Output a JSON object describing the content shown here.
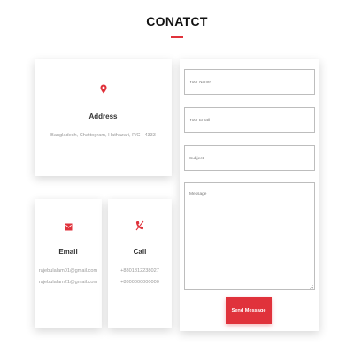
{
  "page": {
    "heading": "CONATCT",
    "accent_color": "#e0323b"
  },
  "address": {
    "icon": "map-pin-icon",
    "title": "Address",
    "text": "Bangladesh, Chattogram, Hathazari, P/C - 4333"
  },
  "email": {
    "icon": "envelope-icon",
    "title": "Email",
    "lines": [
      "rajebulalam01@gmail.com",
      "rajebulalam21@gmail.com"
    ]
  },
  "call": {
    "icon": "phone-off-icon",
    "title": "Call",
    "lines": [
      "+8801812238027",
      "+8800000000000"
    ]
  },
  "form": {
    "name_placeholder": "Your Name",
    "email_placeholder": "Your Email",
    "subject_placeholder": "Subject",
    "message_placeholder": "Message",
    "send_label": "Send Message"
  }
}
